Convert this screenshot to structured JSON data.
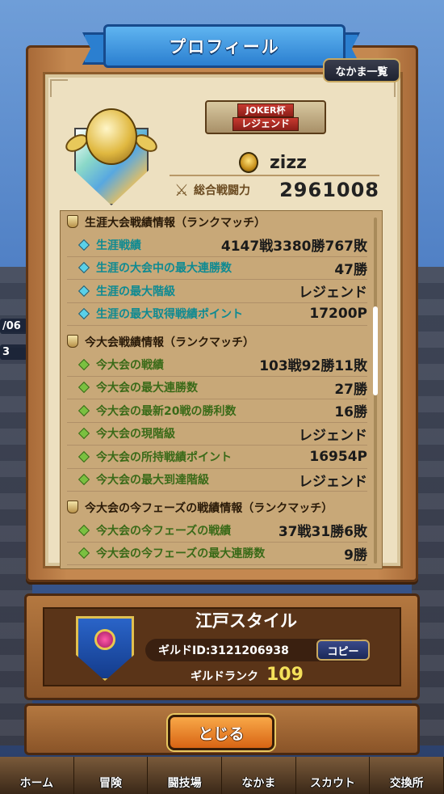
{
  "header": {
    "title": "プロフィール",
    "party_list_button": "なかま一覧"
  },
  "background": {
    "left_badge_1": "/06",
    "left_badge_2": "3"
  },
  "profile": {
    "rank_plate_line1": "JOKER杯",
    "rank_plate_line2": "レジェンド",
    "player_name": "zizz",
    "total_power_label": "総合戦闘力",
    "total_power_value": "2961008"
  },
  "stats": {
    "sections": [
      {
        "title": "生涯大会戦績情報（ランクマッチ）",
        "color": "blue",
        "rows": [
          {
            "label": "生涯戦績",
            "value": "4147戦3380勝767敗"
          },
          {
            "label": "生涯の大会中の最大連勝数",
            "value": "47勝"
          },
          {
            "label": "生涯の最大階級",
            "value": "レジェンド"
          },
          {
            "label": "生涯の最大取得戦績ポイント",
            "value": "17200P"
          }
        ]
      },
      {
        "title": "今大会戦績情報（ランクマッチ）",
        "color": "green",
        "rows": [
          {
            "label": "今大会の戦績",
            "value": "103戦92勝11敗"
          },
          {
            "label": "今大会の最大連勝数",
            "value": "27勝"
          },
          {
            "label": "今大会の最新20戦の勝利数",
            "value": "16勝"
          },
          {
            "label": "今大会の現階級",
            "value": "レジェンド"
          },
          {
            "label": "今大会の所持戦績ポイント",
            "value": "16954P"
          },
          {
            "label": "今大会の最大到達階級",
            "value": "レジェンド"
          }
        ]
      },
      {
        "title": "今大会の今フェーズの戦績情報（ランクマッチ）",
        "color": "green",
        "rows": [
          {
            "label": "今大会の今フェーズの戦績",
            "value": "37戦31勝6敗"
          },
          {
            "label": "今大会の今フェーズの最大連勝数",
            "value": "9勝"
          }
        ]
      }
    ]
  },
  "guild": {
    "name": "江戸スタイル",
    "id_text": "ギルドID:3121206938",
    "copy_button": "コピー",
    "rank_label": "ギルドランク",
    "rank_value": "109"
  },
  "close_button": "とじる",
  "nav": {
    "items": [
      {
        "label": "ホーム",
        "icon": "home-icon"
      },
      {
        "label": "冒険",
        "icon": "adventure-icon"
      },
      {
        "label": "闘技場",
        "icon": "arena-icon"
      },
      {
        "label": "なかま",
        "icon": "party-icon"
      },
      {
        "label": "スカウト",
        "icon": "scout-icon"
      },
      {
        "label": "交換所",
        "icon": "exchange-icon"
      }
    ]
  },
  "colors": {
    "ribbon": "#2b7fd0",
    "lifetime_label": "#0e8a92",
    "current_label": "#3a6a18",
    "guild_rank": "#f4e05a",
    "close_button": "#f08a30"
  }
}
